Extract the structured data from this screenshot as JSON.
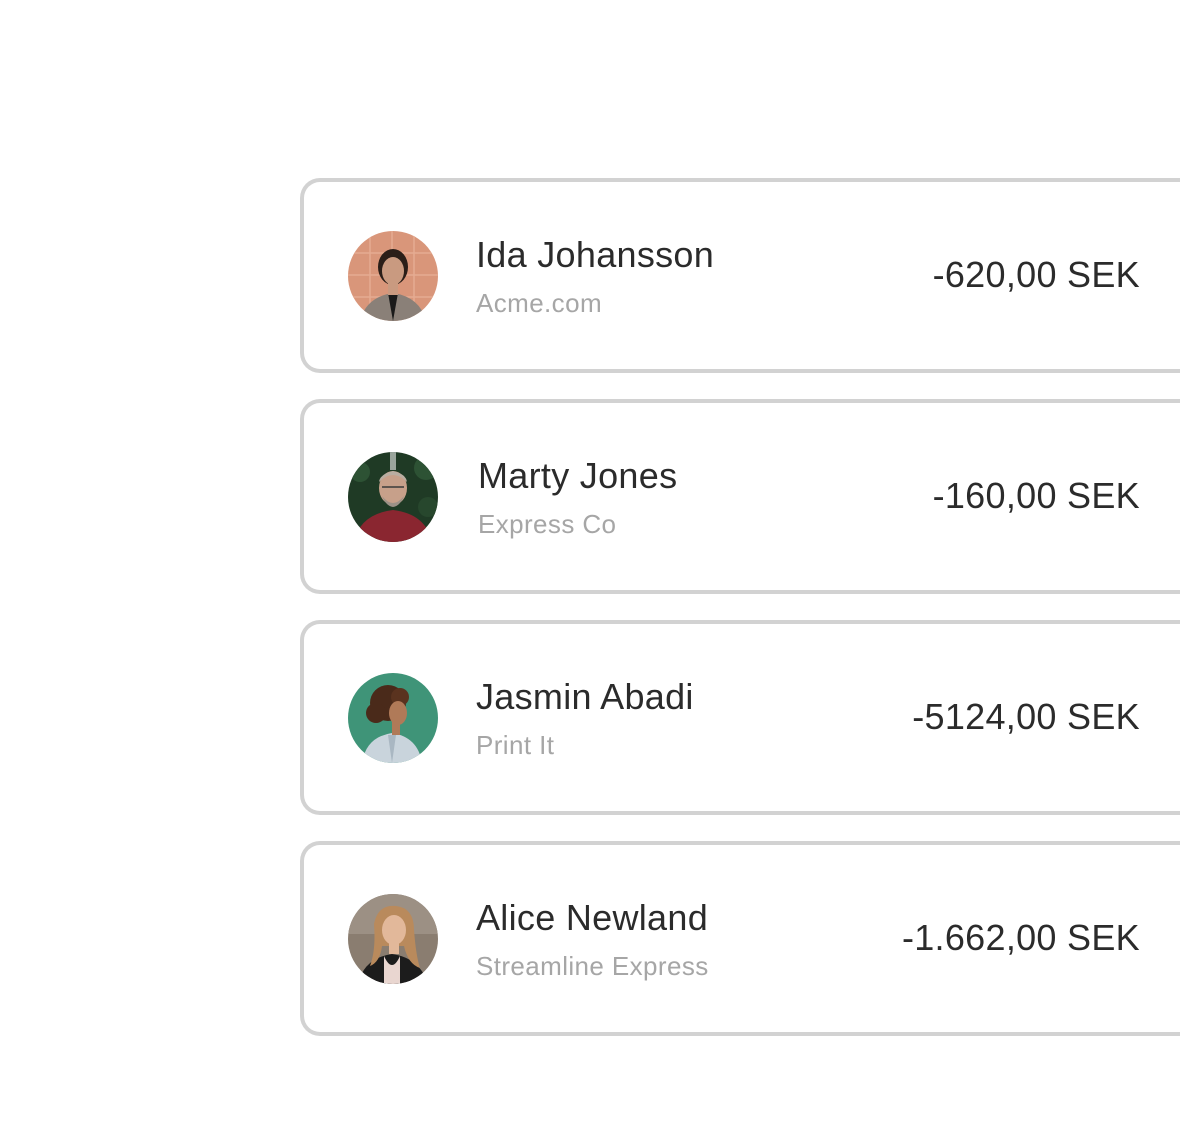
{
  "transactions": [
    {
      "name": "Ida Johansson",
      "company": "Acme.com",
      "amount": "-620,00 SEK",
      "avatar_bg": "#d9967a"
    },
    {
      "name": "Marty Jones",
      "company": "Express Co",
      "amount": "-160,00 SEK",
      "avatar_bg": "#1f3a25"
    },
    {
      "name": "Jasmin Abadi",
      "company": "Print It",
      "amount": "-5124,00 SEK",
      "avatar_bg": "#3f9478"
    },
    {
      "name": "Alice Newland",
      "company": "Streamline Express",
      "amount": "-1.662,00 SEK",
      "avatar_bg": "#8a7d70"
    }
  ]
}
